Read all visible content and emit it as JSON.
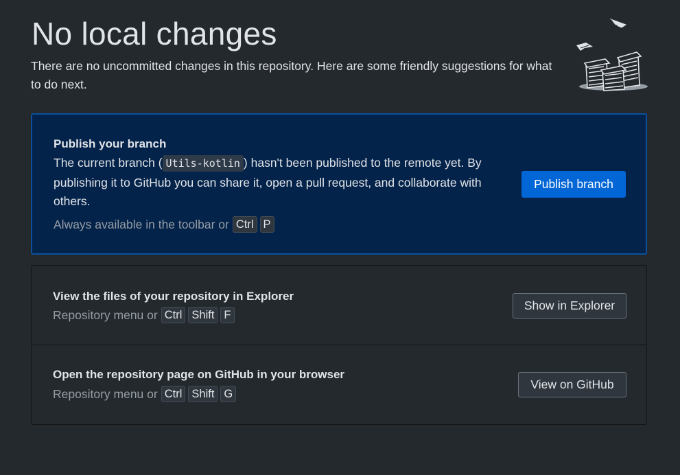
{
  "header": {
    "title": "No local changes",
    "subtitle": "There are no uncommitted changes in this repository. Here are some friendly suggestions for what to do next."
  },
  "illustration": {
    "icon": "paper-stacks-illustration"
  },
  "publish": {
    "title": "Publish your branch",
    "desc_before": "The current branch (",
    "branch_name": "Utils-kotlin",
    "desc_after": ") hasn't been published to the remote yet. By publishing it to GitHub you can share it, open a pull request, and collaborate with others.",
    "hint": "Always available in the toolbar or",
    "keys": [
      "Ctrl",
      "P"
    ],
    "button_label": "Publish branch"
  },
  "explorer": {
    "title": "View the files of your repository in Explorer",
    "hint": "Repository menu or",
    "keys": [
      "Ctrl",
      "Shift",
      "F"
    ],
    "button_label": "Show in Explorer"
  },
  "github": {
    "title": "Open the repository page on GitHub in your browser",
    "hint": "Repository menu or",
    "keys": [
      "Ctrl",
      "Shift",
      "G"
    ],
    "button_label": "View on GitHub"
  },
  "colors": {
    "background": "#24292e",
    "publish_card_bg": "#04234a",
    "publish_card_border": "#0d4f9c",
    "primary_button": "#0366d6"
  }
}
